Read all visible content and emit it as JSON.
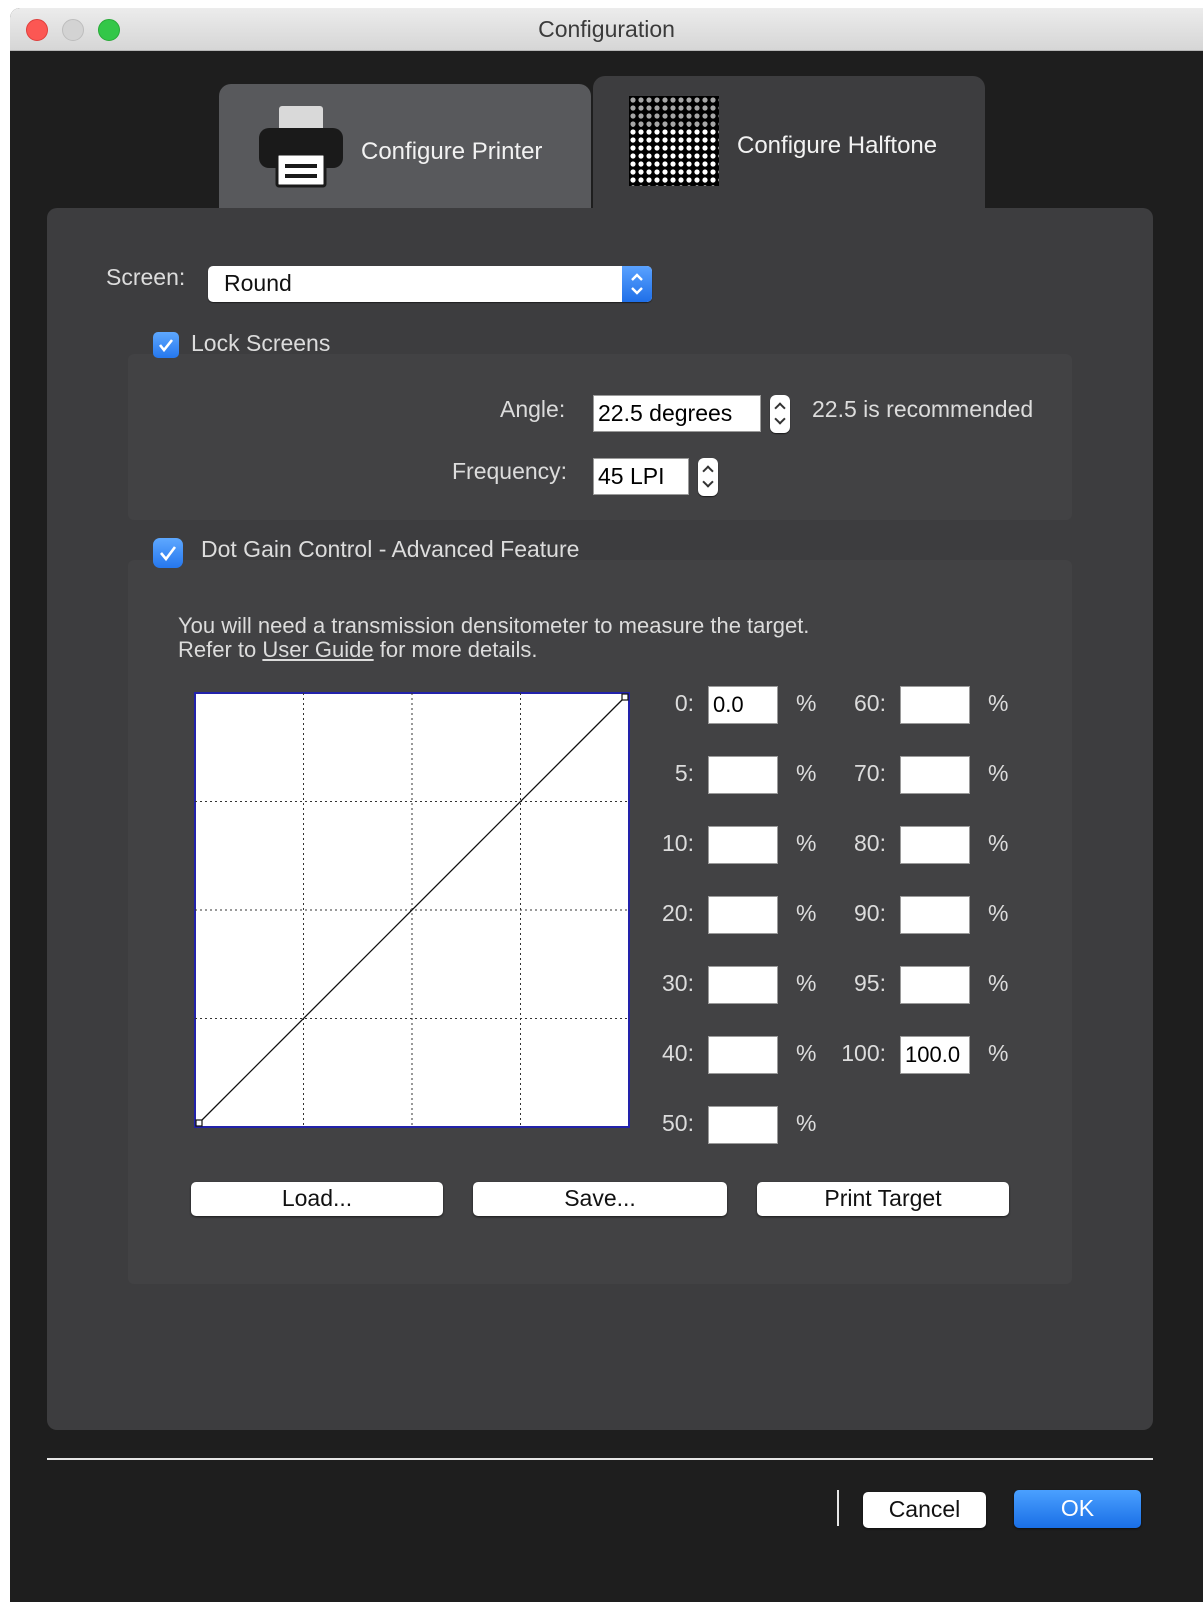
{
  "window": {
    "title": "Configuration"
  },
  "tabs": [
    {
      "label": "Configure Printer",
      "icon": "printer-icon",
      "selected": false
    },
    {
      "label": "Configure Halftone",
      "icon": "halftone-pattern-icon",
      "selected": true
    }
  ],
  "screen": {
    "label": "Screen:",
    "value": "Round"
  },
  "lock_screens": {
    "label": "Lock Screens",
    "checked": true,
    "angle_label": "Angle:",
    "angle_value": "22.5 degrees",
    "angle_hint": "22.5 is recommended",
    "frequency_label": "Frequency:",
    "frequency_value": "45 LPI"
  },
  "dot_gain": {
    "label": "Dot Gain Control - Advanced Feature",
    "checked": true,
    "info_line1": "You will need a transmission densitometer to measure the target.",
    "info_line2_prefix": "Refer to ",
    "info_link": "User Guide",
    "info_line2_suffix": " for more details.",
    "percent_sign": "%",
    "left_column": [
      {
        "label": "0:",
        "value": "0.0"
      },
      {
        "label": "5:",
        "value": ""
      },
      {
        "label": "10:",
        "value": ""
      },
      {
        "label": "20:",
        "value": ""
      },
      {
        "label": "30:",
        "value": ""
      },
      {
        "label": "40:",
        "value": ""
      },
      {
        "label": "50:",
        "value": ""
      }
    ],
    "right_column": [
      {
        "label": "60:",
        "value": ""
      },
      {
        "label": "70:",
        "value": ""
      },
      {
        "label": "80:",
        "value": ""
      },
      {
        "label": "90:",
        "value": ""
      },
      {
        "label": "95:",
        "value": ""
      },
      {
        "label": "100:",
        "value": "100.0"
      }
    ],
    "curve": {
      "x_range": [
        0,
        100
      ],
      "y_range": [
        0,
        100
      ],
      "grid_divisions": 4,
      "points": [
        [
          0,
          0
        ],
        [
          100,
          100
        ]
      ]
    },
    "load_button": "Load...",
    "save_button": "Save...",
    "print_target_button": "Print Target"
  },
  "footer": {
    "cancel_button": "Cancel",
    "ok_button": "OK"
  },
  "colors": {
    "accent": "#1f6fe8",
    "panel": "#3d3d3f",
    "window_bg": "#1e1e1e"
  }
}
